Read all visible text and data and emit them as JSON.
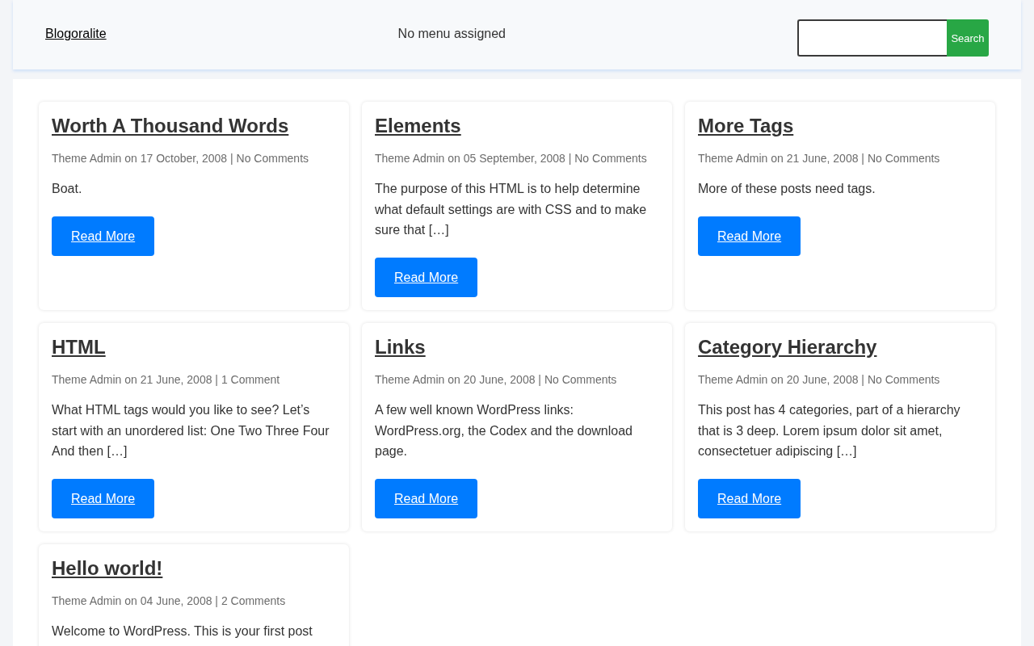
{
  "header": {
    "site_title": "Blogoralite",
    "menu_notice": "No menu assigned",
    "search": {
      "button": "Search"
    }
  },
  "posts": [
    {
      "title": "Worth A Thousand Words",
      "meta": "Theme Admin on 17 October, 2008 | No Comments",
      "excerpt": "Boat.",
      "read_more": "Read More"
    },
    {
      "title": "Elements",
      "meta": "Theme Admin on 05 September, 2008 | No Comments",
      "excerpt": "The purpose of this HTML is to help determine what default settings are with CSS and to make sure that […]",
      "read_more": "Read More"
    },
    {
      "title": "More Tags",
      "meta": "Theme Admin on 21 June, 2008 | No Comments",
      "excerpt": "More of these posts need tags.",
      "read_more": "Read More"
    },
    {
      "title": "HTML",
      "meta": "Theme Admin on 21 June, 2008 | 1 Comment",
      "excerpt": "What HTML tags would you like to see? Let’s start with an unordered list: One Two Three Four And then […]",
      "read_more": "Read More"
    },
    {
      "title": "Links",
      "meta": "Theme Admin on 20 June, 2008 | No Comments",
      "excerpt": "A few well known WordPress links: WordPress.org, the Codex and the download page.",
      "read_more": "Read More"
    },
    {
      "title": "Category Hierarchy",
      "meta": "Theme Admin on 20 June, 2008 | No Comments",
      "excerpt": "This post has 4 categories, part of a hierarchy that is 3 deep. Lorem ipsum dolor sit amet, consectetuer adipiscing […]",
      "read_more": "Read More"
    },
    {
      "title": "Hello world!",
      "meta": "Theme Admin on 04 June, 2008 | 2 Comments",
      "excerpt": "Welcome to WordPress. This is your first post"
    }
  ]
}
